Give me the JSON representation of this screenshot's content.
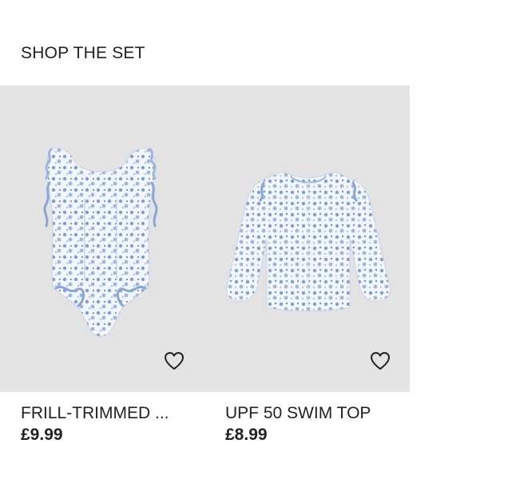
{
  "section": {
    "title": "SHOP THE SET"
  },
  "products": [
    {
      "name": "FRILL-TRIMMED ...",
      "price": "£9.99",
      "image_icon": "swimsuit-image",
      "favorite_icon": "heart-outline-icon"
    },
    {
      "name": "UPF 50 SWIM TOP",
      "price": "£8.99",
      "image_icon": "swim-top-image",
      "favorite_icon": "heart-outline-icon"
    }
  ],
  "colors": {
    "image_background": "#e3e3e3",
    "text": "#222222",
    "garment_base": "#f2f6fb",
    "garment_print": "#7f9fcf"
  }
}
